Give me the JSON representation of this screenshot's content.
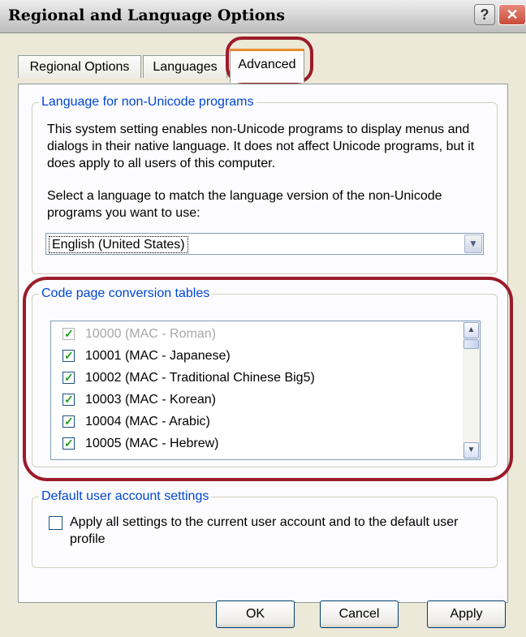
{
  "window": {
    "title": "Regional and Language Options",
    "help_label": "?",
    "close_label": "✕"
  },
  "tabs": [
    {
      "label": "Regional Options",
      "selected": false
    },
    {
      "label": "Languages",
      "selected": false
    },
    {
      "label": "Advanced",
      "selected": true
    }
  ],
  "language_group": {
    "title": "Language for non-Unicode programs",
    "description": "This system setting enables non-Unicode programs to display menus and dialogs in their native language. It does not affect Unicode programs, but it does apply to all users of this computer.",
    "select_label": "Select a language to match the language version of the non-Unicode programs you want to use:",
    "selected_language": "English (United States)",
    "dropdown_icon": "chevron-down-icon"
  },
  "code_page_group": {
    "title": "Code page conversion tables",
    "items": [
      {
        "label": "10000 (MAC - Roman)",
        "checked": true,
        "enabled": false
      },
      {
        "label": "10001 (MAC - Japanese)",
        "checked": true,
        "enabled": true
      },
      {
        "label": "10002 (MAC - Traditional Chinese Big5)",
        "checked": true,
        "enabled": true
      },
      {
        "label": "10003 (MAC - Korean)",
        "checked": true,
        "enabled": true
      },
      {
        "label": "10004 (MAC - Arabic)",
        "checked": true,
        "enabled": true
      },
      {
        "label": "10005 (MAC - Hebrew)",
        "checked": true,
        "enabled": true
      }
    ],
    "scroll_up_icon": "▲",
    "scroll_down_icon": "▼"
  },
  "default_group": {
    "title": "Default user account settings",
    "checkbox_label": "Apply all settings to the current user account and to the default user profile",
    "checked": false
  },
  "buttons": {
    "ok": "OK",
    "cancel": "Cancel",
    "apply": "Apply"
  },
  "colors": {
    "highlight": "#9b1c2a",
    "group_title": "#0046d5",
    "tab_accent": "#e68b2c",
    "check": "#21a121"
  }
}
